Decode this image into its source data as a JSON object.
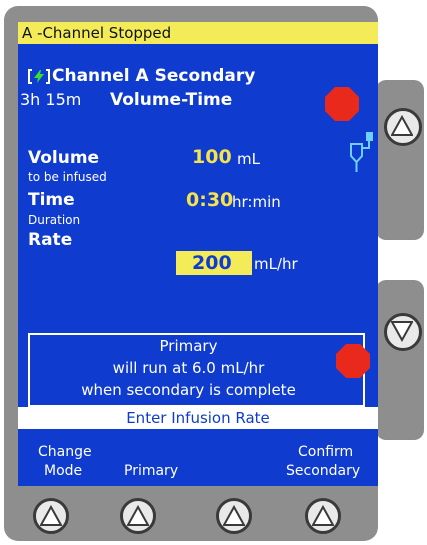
{
  "status": {
    "text": "A -Channel Stopped"
  },
  "header": {
    "channel_title": "Channel A Secondary",
    "time_remaining": "3h 15m",
    "mode": "Volume-Time"
  },
  "fields": {
    "volume": {
      "label": "Volume",
      "sublabel": "to be infused",
      "value": "100",
      "unit": "mL"
    },
    "time": {
      "label": "Time",
      "sublabel": "Duration",
      "value": "0:30",
      "unit": "hr:min"
    },
    "rate": {
      "label": "Rate",
      "value": "200",
      "unit": "mL/hr"
    }
  },
  "info": {
    "line1": "Primary",
    "line2": "will run at 6.0 mL/hr",
    "line3": "when secondary is complete"
  },
  "prompt": "Enter Infusion Rate",
  "softkeys": {
    "key1_line1": "Change",
    "key1_line2": "Mode",
    "key2": "Primary",
    "key4_line1": "Confirm",
    "key4_line2": "Secondary"
  },
  "colors": {
    "screen": "#0f3ccf",
    "status_bar": "#f3ec58",
    "value_text": "#f4e34a",
    "stop_sign": "#e8291c",
    "bezel": "#8e8e8e"
  },
  "icons": {
    "battery": "battery-charging-icon",
    "stop": "stop-sign-icon",
    "drip": "iv-drip-icon",
    "up": "up-arrow-icon",
    "down": "down-arrow-icon"
  }
}
